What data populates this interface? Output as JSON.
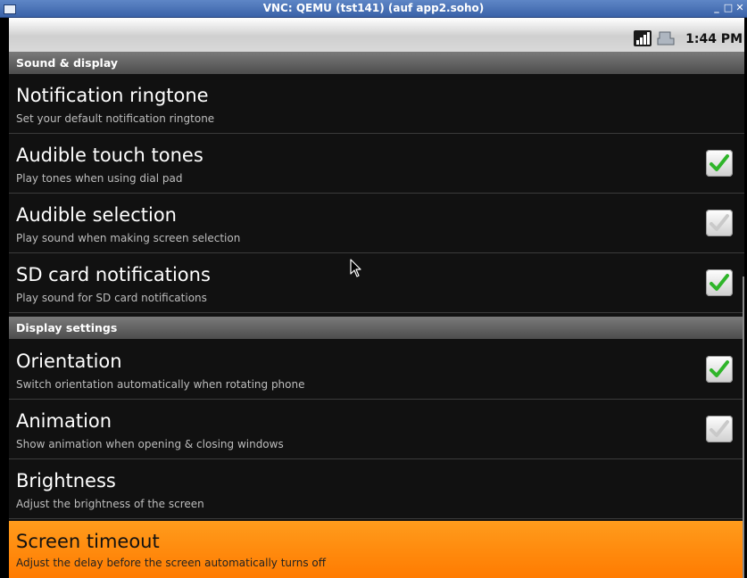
{
  "window": {
    "title": "VNC: QEMU (tst141) (auf app2.soho)",
    "buttons": [
      "_",
      "□",
      "✕"
    ]
  },
  "statusbar": {
    "time": "1:44 PM",
    "icons": [
      "signal-icon",
      "usb-debug-icon"
    ]
  },
  "header": {
    "title": "Sound & display"
  },
  "sections": [
    {
      "title": "",
      "items": [
        {
          "title": "Notification ringtone",
          "summary": "Set your default notification ringtone",
          "checkbox": null
        },
        {
          "title": "Audible touch tones",
          "summary": "Play tones when using dial pad",
          "checkbox": true
        },
        {
          "title": "Audible selection",
          "summary": "Play sound when making screen selection",
          "checkbox": false
        },
        {
          "title": "SD card notifications",
          "summary": "Play sound for SD card notifications",
          "checkbox": true
        }
      ]
    },
    {
      "title": "Display settings",
      "items": [
        {
          "title": "Orientation",
          "summary": "Switch orientation automatically when rotating phone",
          "checkbox": true
        },
        {
          "title": "Animation",
          "summary": "Show animation when opening & closing windows",
          "checkbox": false
        },
        {
          "title": "Brightness",
          "summary": "Adjust the brightness of the screen",
          "checkbox": null
        },
        {
          "title": "Screen timeout",
          "summary": "Adjust the delay before the screen automatically turns off",
          "checkbox": null,
          "selected": true
        }
      ]
    }
  ],
  "colors": {
    "accent": "#ff8a00",
    "check_on": "#2fb52a",
    "check_off": "#c9c9c9"
  }
}
